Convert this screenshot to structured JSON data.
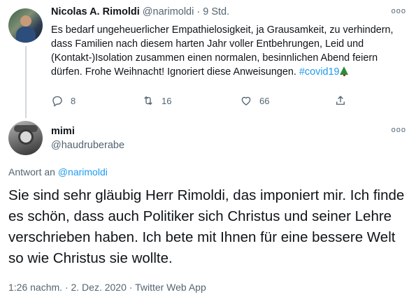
{
  "tweet1": {
    "display_name": "Nicolas A. Rimoldi",
    "handle": "@narimoldi",
    "separator": "·",
    "time": "9 Std.",
    "more": "ooo",
    "text": "Es bedarf ungeheuerlicher Empathielosigkeit, ja Grausamkeit, zu verhindern, dass Familien nach diesem harten Jahr voller Entbehrungen, Leid und (Kontakt-)Isolation zusammen einen normalen, besinnlichen Abend feiern dürfen. Frohe Weihnacht! Ignoriert diese Anweisungen. ",
    "hashtag": "#covid19",
    "actions": {
      "replies": "8",
      "retweets": "16",
      "likes": "66"
    }
  },
  "tweet2": {
    "display_name": "mimi",
    "handle": "@haudruberabe",
    "more": "ooo",
    "reply_prefix": "Antwort an ",
    "reply_target": "@narimoldi",
    "text": "Sie sind sehr gläubig Herr Rimoldi, das imponiert mir. Ich finde es schön, dass auch Politiker sich Christus und seiner Lehre verschrieben haben. Ich bete mit Ihnen für eine bessere Welt so wie Christus sie wollte.",
    "meta": "1:26 nachm. · 2. Dez. 2020 · Twitter Web App"
  },
  "icons": [
    "reply-icon",
    "retweet-icon",
    "like-icon",
    "share-icon",
    "tree-emoji-icon",
    "more-icon"
  ],
  "colors": {
    "link": "#1d9bf0",
    "muted": "#536471",
    "text": "#0f1419"
  }
}
